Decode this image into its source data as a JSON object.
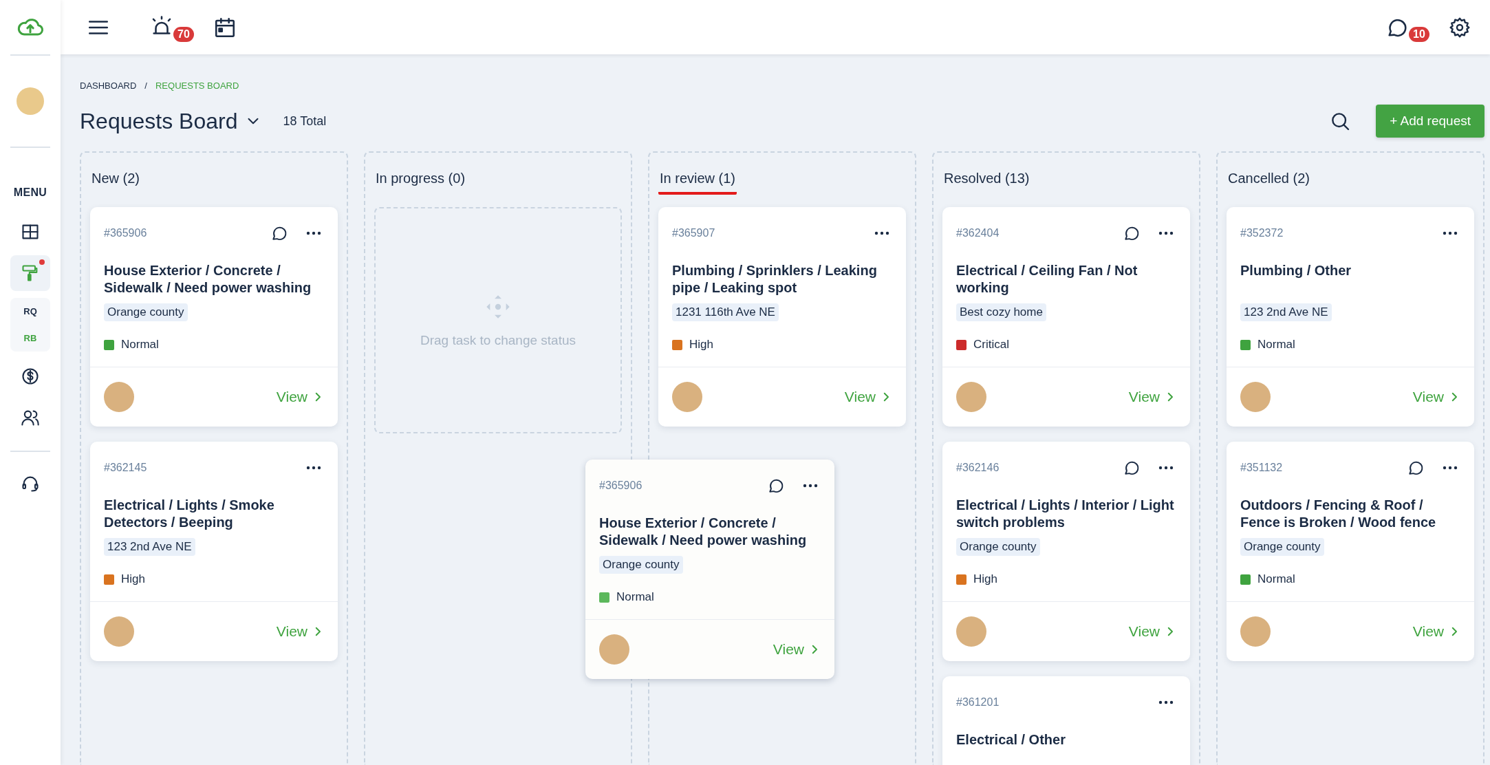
{
  "topbar": {
    "alarm_badge": "70",
    "chat_badge": "10"
  },
  "sidebar": {
    "menu_label": "MENU",
    "items": [
      {
        "kind": "grid",
        "selected": false
      },
      {
        "kind": "roller",
        "selected": true,
        "dot": true
      },
      {
        "kind": "sub",
        "children": [
          {
            "label": "RQ",
            "selected": false
          },
          {
            "label": "RB",
            "selected": true
          }
        ]
      },
      {
        "kind": "dollar",
        "selected": false
      },
      {
        "kind": "people",
        "selected": false
      },
      {
        "kind": "headset",
        "selected": false
      }
    ]
  },
  "breadcrumb": [
    {
      "label": "DASHBOARD",
      "selected": false
    },
    {
      "label": "REQUESTS BOARD",
      "selected": true
    }
  ],
  "breadcrumb_separator": "/",
  "title": "Requests Board",
  "total": "18 Total",
  "add_button": "+ Add request",
  "columns": [
    {
      "title": "New (2)",
      "selected": false,
      "cards": [
        {
          "id": "#365906",
          "comments": true,
          "title": "House Exterior / Concrete / Sidewalk / Need power washing",
          "location": "Orange county",
          "priority": {
            "label": "Normal",
            "color": "#3fa33f"
          },
          "action": "View"
        },
        {
          "id": "#362145",
          "comments": false,
          "title": "Electrical / Lights / Smoke Detectors / Beeping",
          "location": "123 2nd Ave NE",
          "priority": {
            "label": "High",
            "color": "#d9731f"
          },
          "action": "View"
        }
      ]
    },
    {
      "title": "In progress (0)",
      "selected": false,
      "placeholder": "Drag task to change status"
    },
    {
      "title": "In review (1)",
      "selected": true,
      "cards": [
        {
          "id": "#365907",
          "comments": false,
          "title": "Plumbing / Sprinklers / Leaking pipe / Leaking spot",
          "location": "1231 116th Ave NE",
          "priority": {
            "label": "High",
            "color": "#d9731f"
          },
          "action": "View"
        }
      ]
    },
    {
      "title": "Resolved (13)",
      "selected": false,
      "cards": [
        {
          "id": "#362404",
          "comments": true,
          "title": "Electrical / Ceiling Fan / Not working",
          "location": "Best cozy home",
          "priority": {
            "label": "Critical",
            "color": "#cc2b2b"
          },
          "action": "View"
        },
        {
          "id": "#362146",
          "comments": true,
          "title": "Electrical / Lights / Interior / Light switch problems",
          "location": "Orange county",
          "priority": {
            "label": "High",
            "color": "#d9731f"
          },
          "action": "View"
        },
        {
          "id": "#361201",
          "comments": false,
          "title": "Electrical / Other"
        }
      ]
    },
    {
      "title": "Cancelled (2)",
      "selected": false,
      "cards": [
        {
          "id": "#352372",
          "comments": false,
          "title": "Plumbing / Other",
          "location": "123 2nd Ave NE",
          "priority": {
            "label": "Normal",
            "color": "#3fa33f"
          },
          "action": "View"
        },
        {
          "id": "#351132",
          "comments": true,
          "title": "Outdoors / Fencing & Roof / Fence is Broken / Wood fence",
          "location": "Orange county",
          "priority": {
            "label": "Normal",
            "color": "#3fa33f"
          },
          "action": "View"
        }
      ]
    }
  ],
  "dragged_card": {
    "id": "#365906",
    "comments": true,
    "title": "House Exterior / Concrete / Sidewalk / Need power washing",
    "location": "Orange county",
    "priority": {
      "label": "Normal",
      "color": "#5cb85c"
    },
    "action": "View"
  }
}
